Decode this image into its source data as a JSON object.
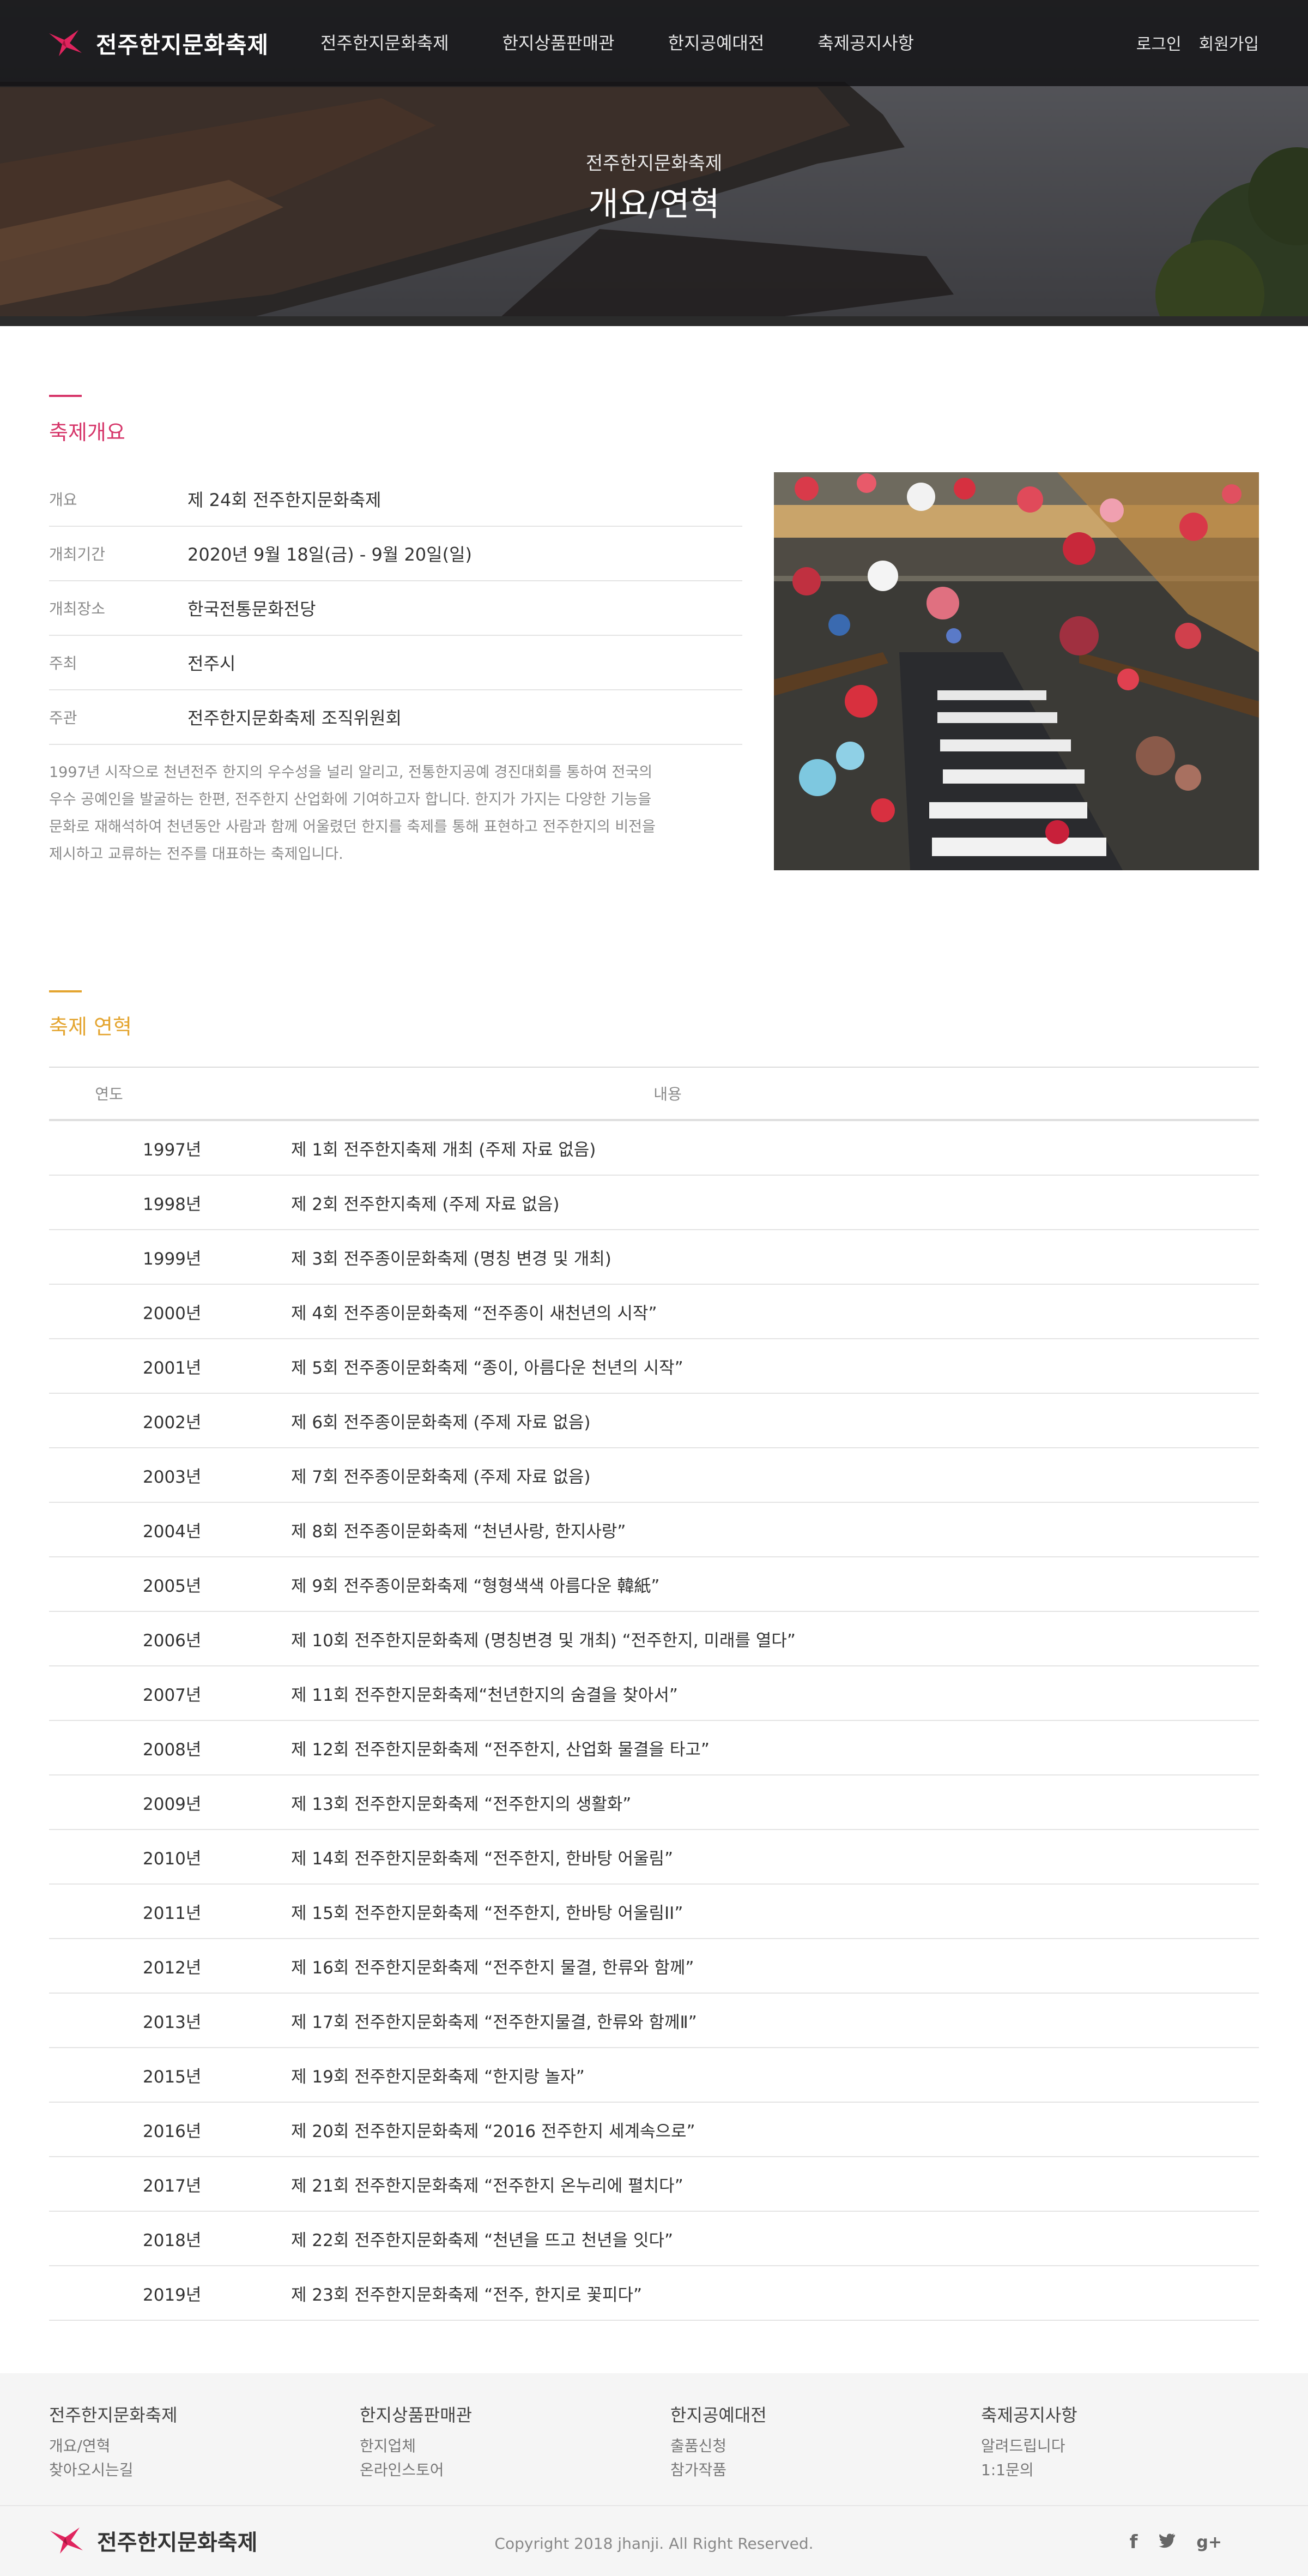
{
  "header": {
    "logo_text": "전주한지문화축제",
    "nav": [
      "전주한지문화축제",
      "한지상품판매관",
      "한지공예대전",
      "축제공지사항"
    ],
    "login": "로그인",
    "signup": "회원가입"
  },
  "hero": {
    "subtitle": "전주한지문화축제",
    "title": "개요/연혁"
  },
  "overview": {
    "title": "축제개요",
    "rows": [
      {
        "label": "개요",
        "value": "제 24회 전주한지문화축제"
      },
      {
        "label": "개최기간",
        "value": "2020년 9월 18일(금) - 9월 20일(일)"
      },
      {
        "label": "개최장소",
        "value": "한국전통문화전당"
      },
      {
        "label": "주최",
        "value": "전주시"
      },
      {
        "label": "주관",
        "value": "전주한지문화축제 조직위원회"
      }
    ],
    "description_lines": [
      "1997년 시작으로 천년전주 한지의 우수성을 널리 알리고, 전통한지공예 경진대회를 통하여 전국의",
      "우수 공예인을 발굴하는 한편, 전주한지 산업화에 기여하고자 합니다. 한지가 가지는 다양한 기능을",
      "문화로 재해석하여 천년동안 사람과 함께 어울렸던 한지를 축제를 통해 표현하고 전주한지의 비전을",
      "제시하고 교류하는 전주를 대표하는 축제입니다."
    ]
  },
  "history": {
    "title": "축제 연혁",
    "col_year": "연도",
    "col_content": "내용",
    "rows": [
      {
        "year": "1997년",
        "content": "제 1회 전주한지축제 개최 (주제 자료 없음)"
      },
      {
        "year": "1998년",
        "content": "제 2회 전주한지축제 (주제 자료 없음)"
      },
      {
        "year": "1999년",
        "content": "제 3회 전주종이문화축제 (명칭 변경 및 개최)"
      },
      {
        "year": "2000년",
        "content": "제 4회 전주종이문화축제 “전주종이 새천년의 시작”"
      },
      {
        "year": "2001년",
        "content": "제 5회 전주종이문화축제 “종이, 아름다운 천년의 시작”"
      },
      {
        "year": "2002년",
        "content": "제 6회 전주종이문화축제 (주제 자료 없음)"
      },
      {
        "year": "2003년",
        "content": "제 7회 전주종이문화축제 (주제 자료 없음)"
      },
      {
        "year": "2004년",
        "content": "제 8회 전주종이문화축제 “천년사랑, 한지사랑”"
      },
      {
        "year": "2005년",
        "content": "제 9회 전주종이문화축제 “형형색색 아름다운 韓紙”"
      },
      {
        "year": "2006년",
        "content": "제 10회 전주한지문화축제 (명칭변경 및 개최) “전주한지, 미래를 열다”"
      },
      {
        "year": "2007년",
        "content": "제 11회 전주한지문화축제“천년한지의 숨결을 찾아서”"
      },
      {
        "year": "2008년",
        "content": "제 12회 전주한지문화축제 “전주한지, 산업화 물결을 타고”"
      },
      {
        "year": "2009년",
        "content": "제 13회 전주한지문화축제 “전주한지의 생활화”"
      },
      {
        "year": "2010년",
        "content": "제 14회 전주한지문화축제 “전주한지, 한바탕 어울림”"
      },
      {
        "year": "2011년",
        "content": "제 15회 전주한지문화축제 “전주한지, 한바탕 어울림II”"
      },
      {
        "year": "2012년",
        "content": "제 16회 전주한지문화축제 “전주한지 물결, 한류와 함께”"
      },
      {
        "year": "2013년",
        "content": "제 17회 전주한지문화축제 “전주한지물결, 한류와 함께Ⅱ”"
      },
      {
        "year": "2015년",
        "content": "제 19회 전주한지문화축제 “한지랑 놀자”"
      },
      {
        "year": "2016년",
        "content": "제 20회 전주한지문화축제 “2016 전주한지 세계속으로”"
      },
      {
        "year": "2017년",
        "content": "제 21회 전주한지문화축제 “전주한지 온누리에 펼치다”"
      },
      {
        "year": "2018년",
        "content": "제 22회 전주한지문화축제 “천년을 뜨고 천년을 잇다”"
      },
      {
        "year": "2019년",
        "content": "제 23회 전주한지문화축제 “전주, 한지로 꽃피다”"
      }
    ]
  },
  "footer": {
    "columns": [
      {
        "title": "전주한지문화축제",
        "links": [
          "개요/연혁",
          "찾아오시는길"
        ]
      },
      {
        "title": "한지상품판매관",
        "links": [
          "한지업체",
          "온라인스토어"
        ]
      },
      {
        "title": "한지공예대전",
        "links": [
          "출품신청",
          "참가작품"
        ]
      },
      {
        "title": "축제공지사항",
        "links": [
          "알려드립니다",
          "1:1문의"
        ]
      }
    ],
    "logo_text": "전주한지문화축제",
    "copyright": "Copyright 2018 jhanji. All Right Reserved.",
    "social": [
      "facebook-icon",
      "twitter-icon",
      "google-plus-icon"
    ]
  },
  "colors": {
    "accent_overview": "#d6366a",
    "accent_history": "#e4a530",
    "header_bg": "#161618",
    "footer_bg": "#f5f5f5"
  }
}
